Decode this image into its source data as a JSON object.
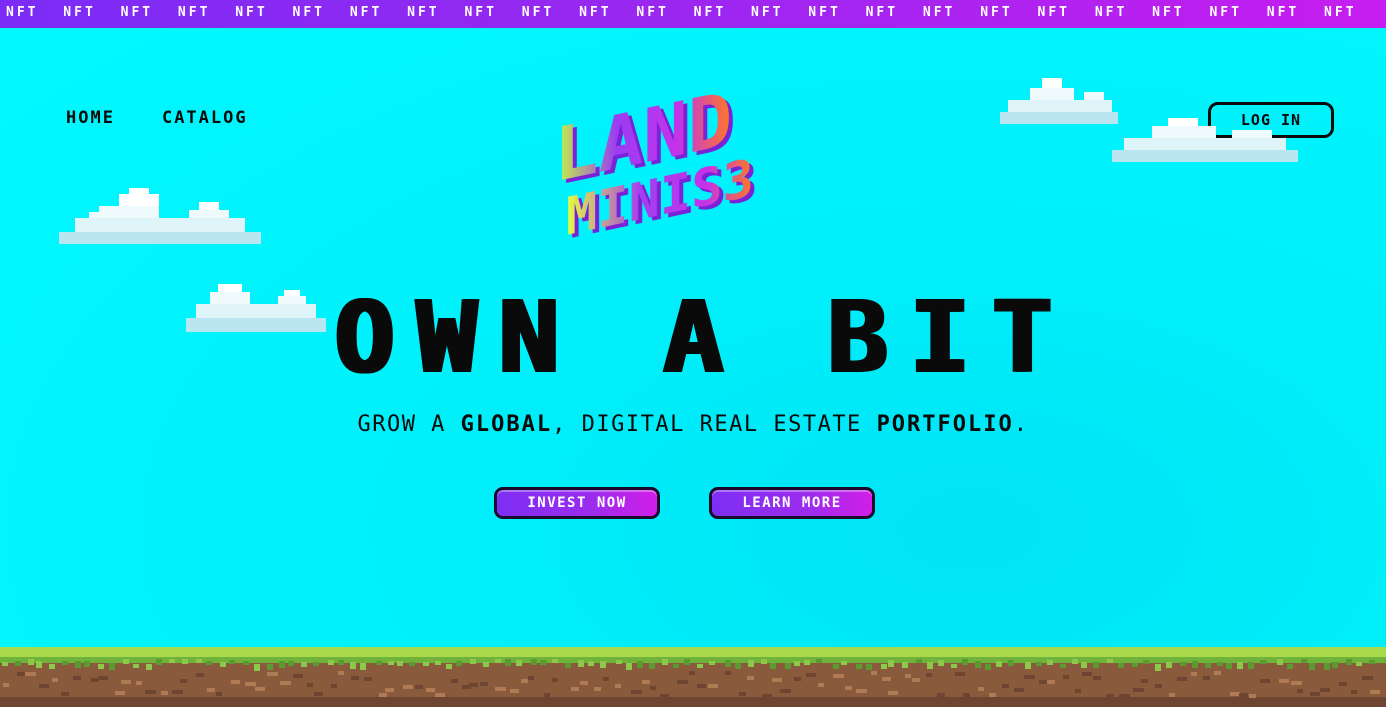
{
  "marquee": {
    "text": "NFT NFT NFT NFT NFT NFT NFT NFT NFT NFT NFT NFT NFT NFT NFT NFT NFT NFT NFT NFT NFT NFT NFT NFT"
  },
  "nav": {
    "home": "HOME",
    "catalog": "CATALOG"
  },
  "auth": {
    "login": "LOG IN"
  },
  "logo": {
    "line1": "LAND",
    "line2": "MINIS3"
  },
  "hero": {
    "title": "OWN A BIT",
    "subtitle_part1": "GROW A ",
    "subtitle_bold1": "GLOBAL",
    "subtitle_part2": ", DIGITAL REAL ESTATE ",
    "subtitle_bold2": "PORTFOLIO",
    "subtitle_part3": "."
  },
  "actions": {
    "invest": "INVEST NOW",
    "learn": "LEARN MORE"
  },
  "colors": {
    "sky": "#00f5fd",
    "marquee": "#8a2bf2",
    "button": "#9c2cee",
    "grass": "#7dc23a",
    "dirt": "#8a5a3c"
  }
}
